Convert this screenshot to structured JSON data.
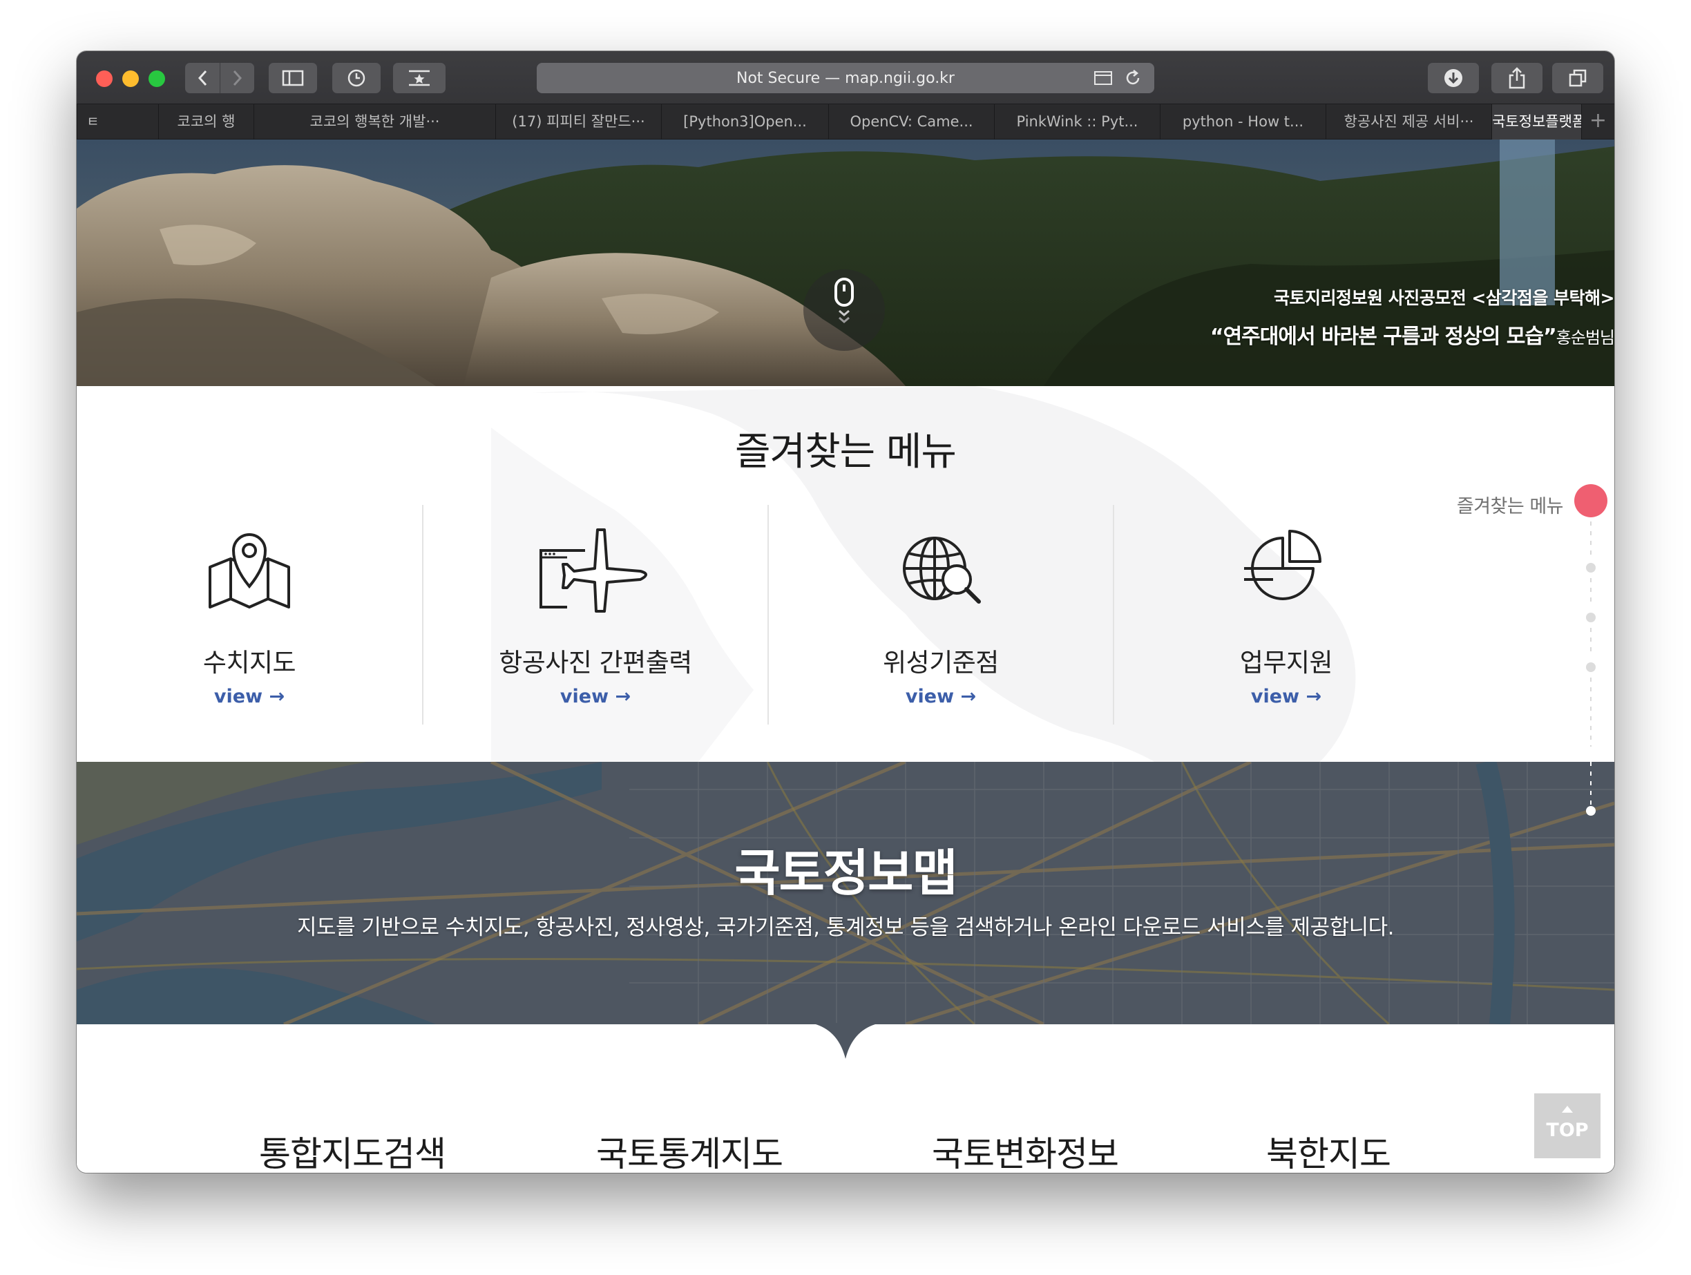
{
  "browser": {
    "address": "Not Secure — map.ngii.go.kr",
    "tabs": [
      {
        "label": "코코의 행",
        "active": false
      },
      {
        "label": "코코의 행복한 개발···",
        "active": false
      },
      {
        "label": "(17) 피피티 잘만드···",
        "active": false
      },
      {
        "label": "[Python3]Open...",
        "active": false
      },
      {
        "label": "OpenCV: Came...",
        "active": false
      },
      {
        "label": "PinkWink :: Pyt...",
        "active": false
      },
      {
        "label": "python - How t...",
        "active": false
      },
      {
        "label": "항공사진 제공 서비···",
        "active": false
      },
      {
        "label": "국토정보플랫폼",
        "active": true
      }
    ],
    "new_tab": "+"
  },
  "hero": {
    "caption_line1": "국토지리정보원 사진공모전 <삼각점을 부탁해>",
    "caption_line2": "“연주대에서 바라본 구름과 정상의 모습”",
    "caption_credit": "홍순범님"
  },
  "favorites": {
    "title": "즐겨찾는 메뉴",
    "side_nav_label": "즐겨찾는 메뉴",
    "items": [
      {
        "label": "수치지도",
        "view": "view",
        "icon": "folded-map-pin-icon"
      },
      {
        "label": "항공사진 간편출력",
        "view": "view",
        "icon": "airplane-photo-icon"
      },
      {
        "label": "위성기준점",
        "view": "view",
        "icon": "globe-search-icon"
      },
      {
        "label": "업무지원",
        "view": "view",
        "icon": "pie-chart-icon"
      }
    ],
    "accent_color": "#ef5f71",
    "link_color": "#3c5ea9"
  },
  "ngii_map": {
    "title": "국토정보맵",
    "description": "지도를 기반으로 수치지도, 항공사진, 정사영상, 국가기준점, 통계정보 등을 검색하거나 온라인 다운로드 서비스를 제공합니다."
  },
  "bottom_menu": {
    "items": [
      "통합지도검색",
      "국토통계지도",
      "국토변화정보",
      "북한지도"
    ],
    "top_button": "TOP"
  }
}
